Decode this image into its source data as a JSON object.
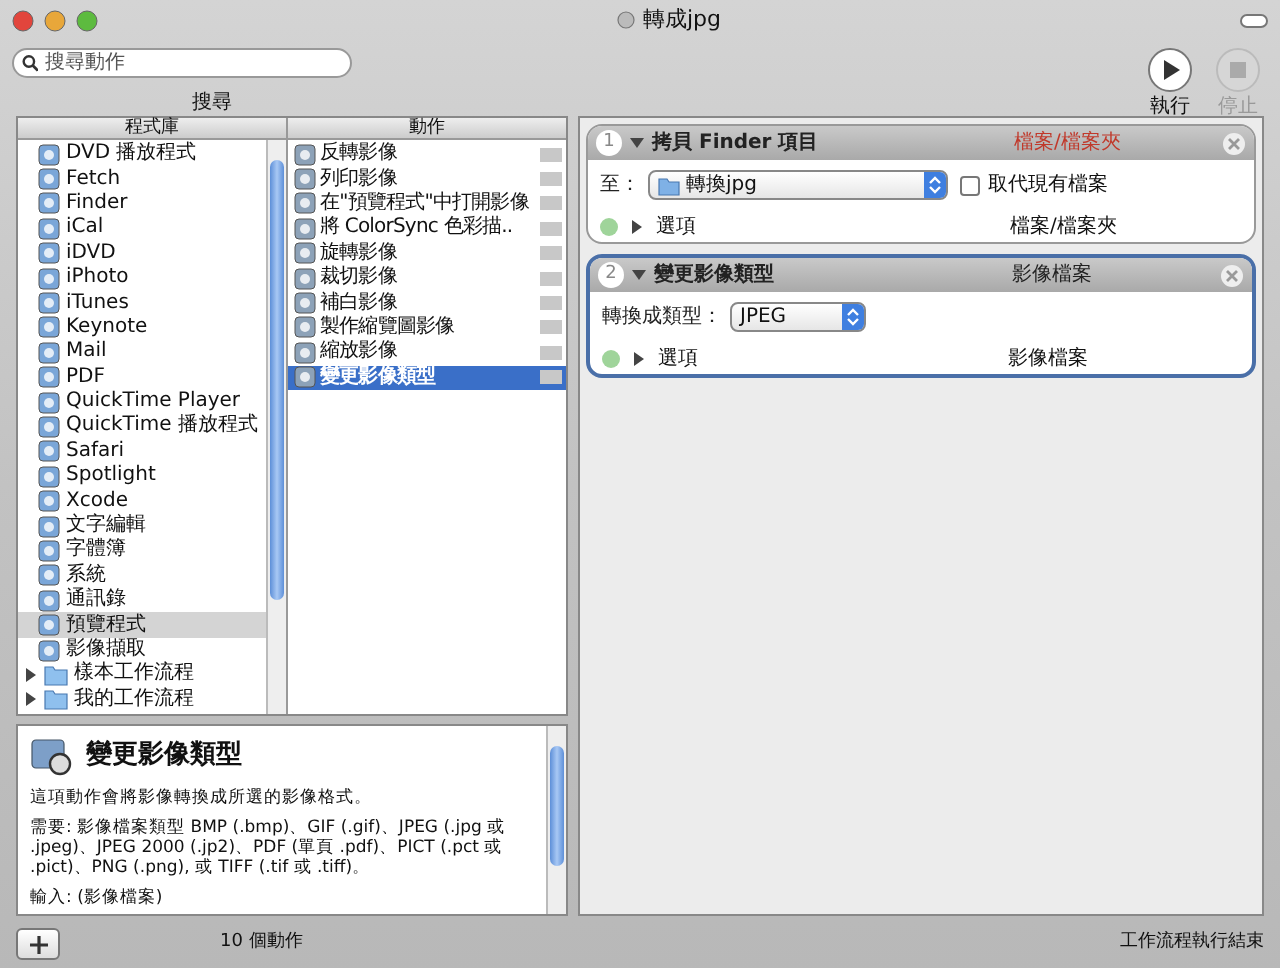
{
  "window": {
    "title": "轉成jpg"
  },
  "toolbar": {
    "search": {
      "placeholder": "搜尋動作"
    },
    "search_label": "搜尋",
    "buttons": [
      {
        "kind": "run",
        "label": "執行",
        "disabled": false
      },
      {
        "kind": "stop",
        "label": "停止",
        "disabled": true
      }
    ]
  },
  "library": {
    "heading": "程式庫",
    "items": [
      {
        "label": "DVD 播放程式",
        "selected": false
      },
      {
        "label": "Fetch",
        "selected": false
      },
      {
        "label": "Finder",
        "selected": false
      },
      {
        "label": "iCal",
        "selected": false
      },
      {
        "label": "iDVD",
        "selected": false
      },
      {
        "label": "iPhoto",
        "selected": false
      },
      {
        "label": "iTunes",
        "selected": false
      },
      {
        "label": "Keynote",
        "selected": false
      },
      {
        "label": "Mail",
        "selected": false
      },
      {
        "label": "PDF",
        "selected": false
      },
      {
        "label": "QuickTime Player",
        "selected": false
      },
      {
        "label": "QuickTime 播放程式",
        "selected": false
      },
      {
        "label": "Safari",
        "selected": false
      },
      {
        "label": "Spotlight",
        "selected": false
      },
      {
        "label": "Xcode",
        "selected": false
      },
      {
        "label": "文字編輯",
        "selected": false
      },
      {
        "label": "字體簿",
        "selected": false
      },
      {
        "label": "系統",
        "selected": false
      },
      {
        "label": "通訊錄",
        "selected": false
      },
      {
        "label": "預覽程式",
        "selected": true
      },
      {
        "label": "影像擷取",
        "selected": false
      }
    ],
    "folders": [
      {
        "label": "樣本工作流程",
        "expanded": false
      },
      {
        "label": "我的工作流程",
        "expanded": false
      }
    ]
  },
  "actions": {
    "heading": "動作",
    "items": [
      {
        "label": "反轉影像",
        "selected": false
      },
      {
        "label": "列印影像",
        "selected": false
      },
      {
        "label": "在\"預覽程式\"中打開影像",
        "selected": false
      },
      {
        "label": "將 ColorSync 色彩描..",
        "selected": false
      },
      {
        "label": "旋轉影像",
        "selected": false
      },
      {
        "label": "裁切影像",
        "selected": false
      },
      {
        "label": "補白影像",
        "selected": false
      },
      {
        "label": "製作縮覽圖影像",
        "selected": false
      },
      {
        "label": "縮放影像",
        "selected": false
      },
      {
        "label": "變更影像類型",
        "selected": true
      }
    ]
  },
  "description": {
    "title": "變更影像類型",
    "paragraphs": [
      "這項動作會將影像轉換成所選的影像格式。",
      "需要: 影像檔案類型 BMP (.bmp)、GIF (.gif)、JPEG (.jpg 或 .jpeg)、JPEG 2000 (.jp2)、PDF (單頁 .pdf)、PICT (.pct 或 .pict)、PNG (.png), 或 TIFF (.tif 或 .tiff)。",
      "輸入: (影像檔案)"
    ]
  },
  "workflow": [
    {
      "number": "1",
      "title": "拷貝 Finder 項目",
      "input_type": "檔案/檔案夾",
      "input_mismatch": true,
      "selected": false,
      "expanded": true,
      "fields": [
        {
          "kind": "popup",
          "label": "至：",
          "value": "轉換jpg",
          "folder": true
        },
        {
          "kind": "checkbox",
          "label": "取代現有檔案",
          "checked": false
        }
      ],
      "options_label": "選項",
      "output_type": "檔案/檔案夾"
    },
    {
      "number": "2",
      "title": "變更影像類型",
      "input_type": "影像檔案",
      "input_mismatch": false,
      "selected": true,
      "expanded": true,
      "fields": [
        {
          "kind": "popup",
          "label": "轉換成類型：",
          "value": "JPEG",
          "folder": false
        }
      ],
      "options_label": "選項",
      "output_type": "影像檔案"
    }
  ],
  "status_bar": {
    "count": "10 個動作",
    "status": "工作流程執行結束"
  }
}
